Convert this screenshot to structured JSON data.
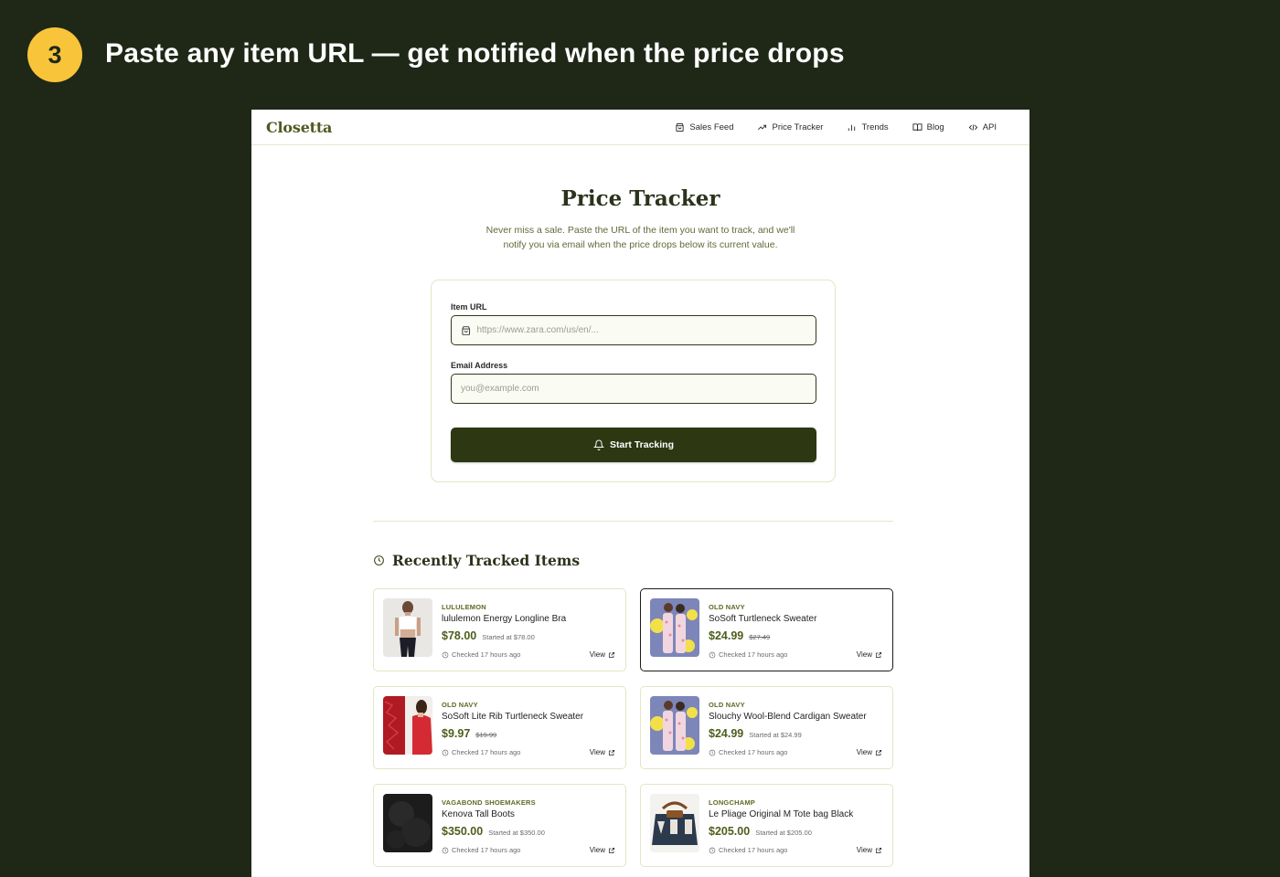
{
  "step": {
    "number": "3",
    "title": "Paste any item URL — get notified when the price drops"
  },
  "nav": {
    "logo": "Closetta",
    "links": [
      {
        "label": "Sales Feed",
        "icon": "shopping-bag-icon"
      },
      {
        "label": "Price Tracker",
        "icon": "trending-up-icon"
      },
      {
        "label": "Trends",
        "icon": "bar-chart-icon"
      },
      {
        "label": "Blog",
        "icon": "book-icon"
      },
      {
        "label": "API",
        "icon": "code-icon"
      }
    ]
  },
  "hero": {
    "title": "Price Tracker",
    "subtitle_line1": "Never miss a sale. Paste the URL of the item you want to track, and we'll",
    "subtitle_line2": "notify you via email when the price drops below its current value."
  },
  "form": {
    "url_label": "Item URL",
    "url_placeholder": "https://www.zara.com/us/en/...",
    "url_value": "",
    "email_label": "Email Address",
    "email_placeholder": "you@example.com",
    "email_value": "",
    "submit_label": "Start Tracking"
  },
  "recent": {
    "title": "Recently Tracked Items",
    "view_label": "View",
    "items": [
      {
        "brand": "LULULEMON",
        "name": "lululemon Energy Longline Bra",
        "price": "$78.00",
        "was": "Started at $78.00",
        "strike": false,
        "checked": "Checked 17 hours ago",
        "selected": false
      },
      {
        "brand": "OLD NAVY",
        "name": "SoSoft Turtleneck Sweater",
        "price": "$24.99",
        "was": "$27.49",
        "strike": true,
        "checked": "Checked 17 hours ago",
        "selected": true
      },
      {
        "brand": "OLD NAVY",
        "name": "SoSoft Lite Rib Turtleneck Sweater",
        "price": "$9.97",
        "was": "$19.99",
        "strike": true,
        "checked": "Checked 17 hours ago",
        "selected": false
      },
      {
        "brand": "OLD NAVY",
        "name": "Slouchy Wool-Blend Cardigan Sweater",
        "price": "$24.99",
        "was": "Started at $24.99",
        "strike": false,
        "checked": "Checked 17 hours ago",
        "selected": false
      },
      {
        "brand": "VAGABOND SHOEMAKERS",
        "name": "Kenova Tall Boots",
        "price": "$350.00",
        "was": "Started at $350.00",
        "strike": false,
        "checked": "Checked 17 hours ago",
        "selected": false
      },
      {
        "brand": "LONGCHAMP",
        "name": "Le Pliage Original M Tote bag Black",
        "price": "$205.00",
        "was": "Started at $205.00",
        "strike": false,
        "checked": "Checked 17 hours ago",
        "selected": false
      }
    ]
  },
  "colors": {
    "page_bg": "#1f2817",
    "badge": "#f8c53a",
    "accent_dark": "#2d3712",
    "price_green": "#4e5e1c"
  }
}
